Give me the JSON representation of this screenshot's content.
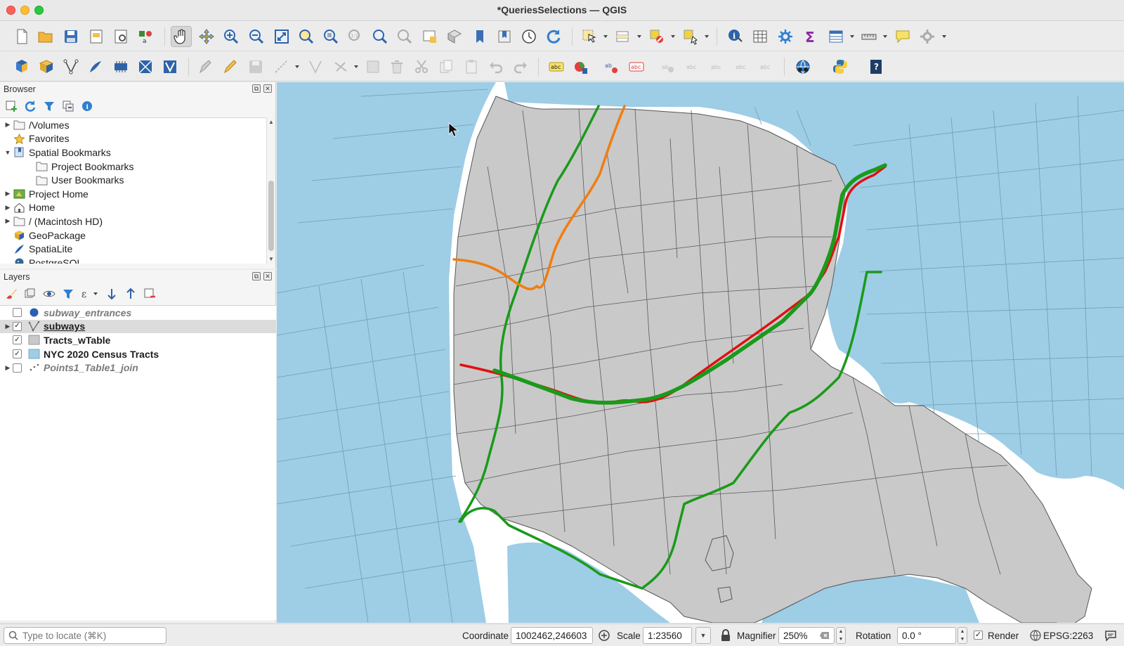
{
  "window": {
    "title": "*QueriesSelections — QGIS"
  },
  "browser": {
    "title": "Browser",
    "items": [
      {
        "label": "/Volumes",
        "icon": "folder-icon",
        "expand": "collapsed"
      },
      {
        "label": "Favorites",
        "icon": "star-icon",
        "expand": "none"
      },
      {
        "label": "Spatial Bookmarks",
        "icon": "bookmark-icon",
        "expand": "expanded"
      },
      {
        "label": "Project Bookmarks",
        "icon": "folder-icon",
        "expand": "child"
      },
      {
        "label": "User Bookmarks",
        "icon": "folder-icon",
        "expand": "child"
      },
      {
        "label": "Project Home",
        "icon": "project-home-icon",
        "expand": "collapsed"
      },
      {
        "label": "Home",
        "icon": "home-icon",
        "expand": "collapsed"
      },
      {
        "label": "/ (Macintosh HD)",
        "icon": "folder-icon",
        "expand": "collapsed"
      },
      {
        "label": "GeoPackage",
        "icon": "geopackage-icon",
        "expand": "none"
      },
      {
        "label": "SpatiaLite",
        "icon": "spatialite-icon",
        "expand": "none"
      },
      {
        "label": "PostgreSQL",
        "icon": "postgresql-icon",
        "expand": "none"
      }
    ]
  },
  "layers": {
    "title": "Layers",
    "items": [
      {
        "label": "subway_entrances",
        "checked": false,
        "style": "italic",
        "icon": "point-layer-icon"
      },
      {
        "label": "subways",
        "checked": true,
        "style": "selected",
        "icon": "line-layer-icon"
      },
      {
        "label": "Tracts_wTable",
        "checked": true,
        "style": "normal",
        "icon": "gray-polygon-icon"
      },
      {
        "label": "NYC 2020 Census Tracts",
        "checked": true,
        "style": "normal",
        "icon": "blue-polygon-icon"
      },
      {
        "label": "Points1_Table1_join",
        "checked": false,
        "style": "italic",
        "icon": "points-layer-icon"
      }
    ]
  },
  "status": {
    "locate_placeholder": "Type to locate (⌘K)",
    "coordinate_label": "Coordinate",
    "coordinate_value": "1002462,246603",
    "scale_label": "Scale",
    "scale_value": "1:23560",
    "magnifier_label": "Magnifier",
    "magnifier_value": "250%",
    "rotation_label": "Rotation",
    "rotation_value": "0.0 °",
    "render_label": "Render",
    "crs": "EPSG:2263"
  },
  "colors": {
    "water": "#9ecde6",
    "land": "#c9c9c9",
    "subway_green": "#1a9a1a",
    "subway_orange": "#f07d10",
    "subway_red": "#e01010"
  }
}
